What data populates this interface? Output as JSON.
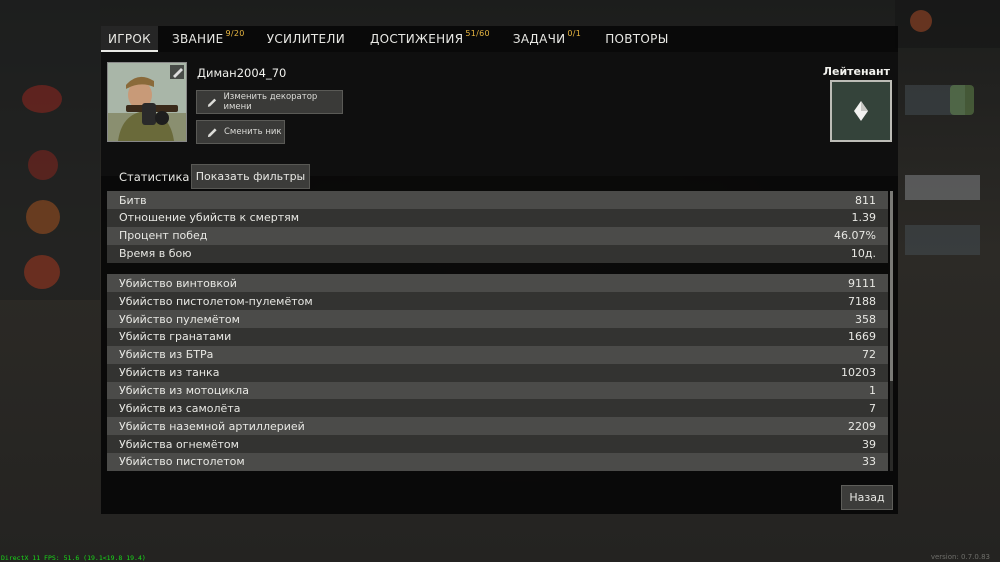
{
  "tabs": [
    {
      "label": "ИГРОК",
      "badge": ""
    },
    {
      "label": "ЗВАНИЕ",
      "badge": "9/20"
    },
    {
      "label": "УСИЛИТЕЛИ",
      "badge": ""
    },
    {
      "label": "ДОСТИЖЕНИЯ",
      "badge": "51/60"
    },
    {
      "label": "ЗАДАЧИ",
      "badge": "0/1"
    },
    {
      "label": "ПОВТОРЫ",
      "badge": ""
    }
  ],
  "player": {
    "nickname": "Диман2004_70",
    "change_decorator_label": "Изменить декоратор имени",
    "change_nick_label": "Сменить ник",
    "rank": "Лейтенант"
  },
  "stats": {
    "title": "Статистика",
    "filters_label": "Показать фильтры",
    "general": [
      {
        "label": "Битв",
        "value": "811"
      },
      {
        "label": "Отношение убийств к смертям",
        "value": "1.39"
      },
      {
        "label": "Процент побед",
        "value": "46.07%"
      },
      {
        "label": "Время в бою",
        "value": "10д."
      }
    ],
    "kills": [
      {
        "label": "Убийство винтовкой",
        "value": "9111"
      },
      {
        "label": "Убийство пистолетом-пулемётом",
        "value": "7188"
      },
      {
        "label": "Убийство пулемётом",
        "value": "358"
      },
      {
        "label": "Убийств гранатами",
        "value": "1669"
      },
      {
        "label": "Убийств из БТРа",
        "value": "72"
      },
      {
        "label": "Убийств из танка",
        "value": "10203"
      },
      {
        "label": "Убийств из мотоцикла",
        "value": "1"
      },
      {
        "label": "Убийств из самолёта",
        "value": "7"
      },
      {
        "label": "Убийств наземной артиллерией",
        "value": "2209"
      },
      {
        "label": "Убийства огнемётом",
        "value": "39"
      },
      {
        "label": "Убийство пистолетом",
        "value": "33"
      }
    ]
  },
  "footer": {
    "back_label": "Назад",
    "fps_text": "DirectX 11 FPS: 51.6 (19.1<19.8 19.4)",
    "version_text": "version: 0.7.0.83"
  },
  "colors": {
    "badge": "#e8b640",
    "row_light": "#4b4b49",
    "row_dark": "#333331",
    "fps": "#19d819"
  },
  "icons": [
    "pencil-icon",
    "rank-insignia-icon",
    "player-avatar"
  ]
}
